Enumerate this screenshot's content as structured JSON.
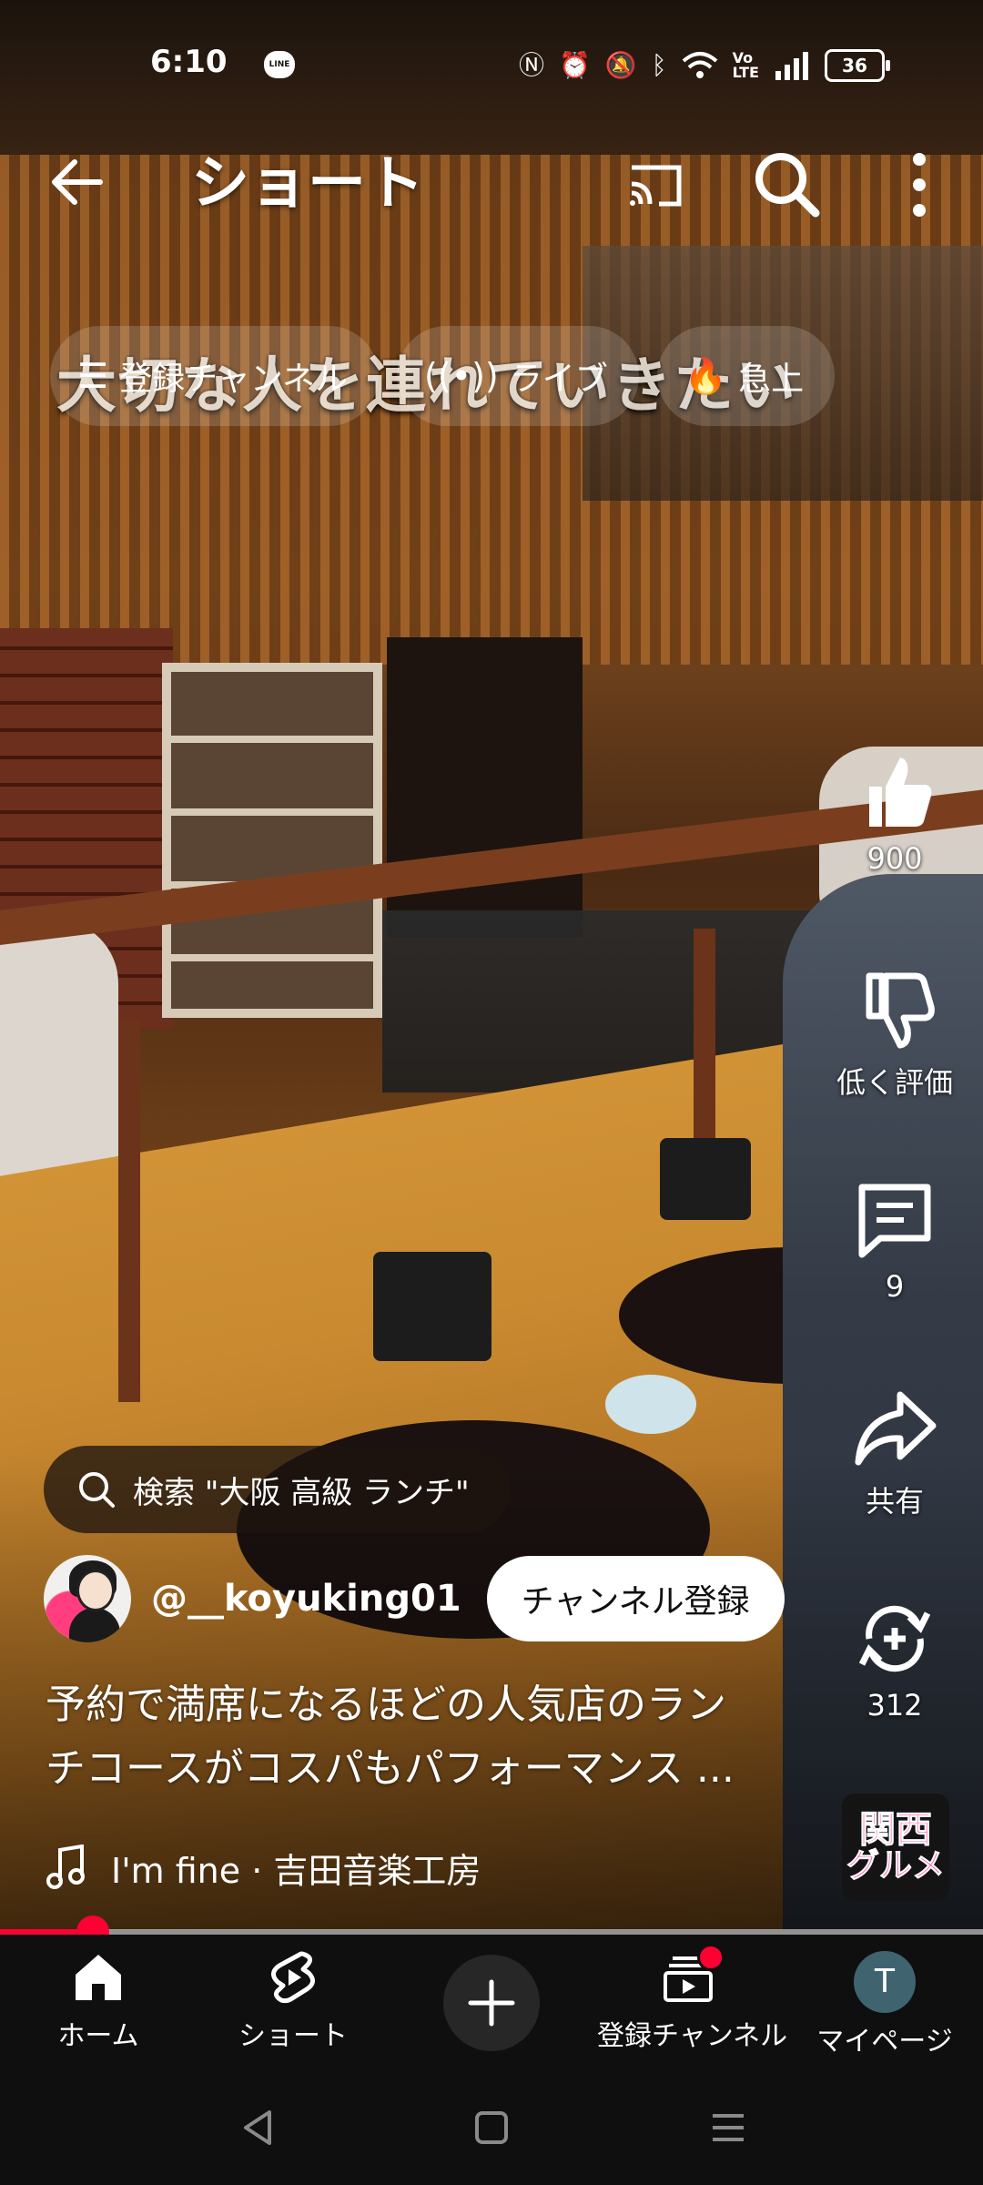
{
  "status_bar": {
    "time": "6:10",
    "line_badge": "LINE",
    "battery": "36"
  },
  "app_bar": {
    "title": "ショート"
  },
  "video": {
    "subtitle": "大切な人を連れていきたい"
  },
  "chips": [
    {
      "icon": "subscriptions-icon",
      "label": "登録チャンネル"
    },
    {
      "icon": "live-icon",
      "label": "ライブ"
    },
    {
      "icon": "trending-icon",
      "label": "急上"
    }
  ],
  "actions": {
    "like_count": "900",
    "dislike_label": "低く評価",
    "comment_count": "9",
    "share_label": "共有",
    "remix_count": "312"
  },
  "sound_thumbnail": {
    "line1": "関西",
    "line2": "グルメ"
  },
  "search_chip": {
    "text": "検索 \"大阪 高級 ランチ\""
  },
  "channel": {
    "handle": "@__koyuking01",
    "subscribe_label": "チャンネル登録"
  },
  "description": {
    "line1": "予約で満席になるほどの人気店のラン",
    "line2": "チコースがコスパもパフォーマンス ..."
  },
  "music": {
    "track": "I'm fine · 吉田音楽工房"
  },
  "progress": {
    "played_fraction": 0.094
  },
  "bottom_nav": {
    "home": "ホーム",
    "shorts": "ショート",
    "subscriptions": "登録チャンネル",
    "you": "マイページ",
    "avatar_initial": "T"
  },
  "colors": {
    "accent": "#ff0033",
    "background": "#0f0f0f"
  }
}
